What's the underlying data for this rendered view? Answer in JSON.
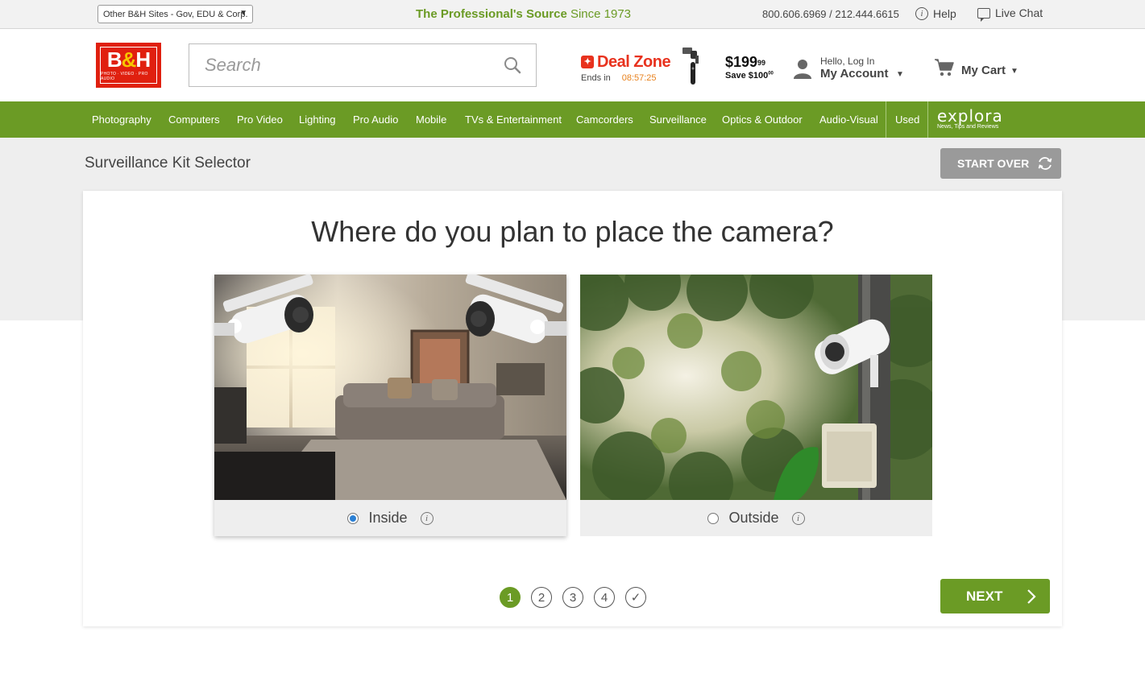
{
  "topbar": {
    "sites_select": "Other B&H Sites - Gov, EDU & Corp.",
    "tagline_bold": "The Professional's Source",
    "tagline_rest": " Since 1973",
    "phones": "800.606.6969 / 212.444.6615",
    "help": "Help",
    "live_chat": "Live Chat"
  },
  "header": {
    "logo_main_b": "B",
    "logo_main_amp": "&",
    "logo_main_h": "H",
    "logo_sub": "PHOTO · VIDEO · PRO AUDIO",
    "search_placeholder": "Search",
    "dealzone": {
      "title": "Deal Zone",
      "ends_in": "Ends in",
      "timer": "08:57:25"
    },
    "deal_price": "$199",
    "deal_price_cents": "99",
    "deal_save": "Save $100",
    "deal_save_cents": "00",
    "account_hello": "Hello, Log In",
    "account_label": "My Account",
    "cart_label": "My Cart"
  },
  "nav": {
    "items": [
      "Photography",
      "Computers",
      "Pro Video",
      "Lighting",
      "Pro Audio",
      "Mobile",
      "TVs & Entertainment",
      "Camcorders",
      "Surveillance",
      "Optics & Outdoor",
      "Audio-Visual",
      "Used"
    ],
    "explora_word": "explora",
    "explora_sub": "News, Tips and Reviews"
  },
  "page": {
    "title": "Surveillance Kit Selector",
    "start_over": "START OVER",
    "question": "Where do you plan to place the camera?",
    "options": [
      {
        "label": "Inside",
        "selected": true
      },
      {
        "label": "Outside",
        "selected": false
      }
    ],
    "steps": [
      "1",
      "2",
      "3",
      "4",
      "✓"
    ],
    "current_step": "1",
    "next": "NEXT"
  },
  "colors": {
    "brand_green": "#6b9b25",
    "logo_red": "#e0200f",
    "dealzone_red": "#e8321e",
    "timer_orange": "#e8821e",
    "radio_blue": "#2a7fd4"
  }
}
